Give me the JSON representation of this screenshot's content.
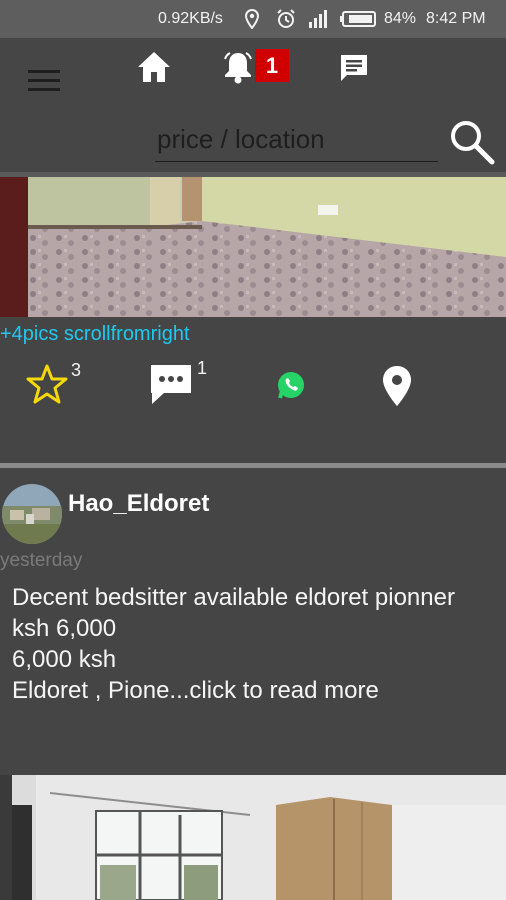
{
  "status_bar": {
    "speed": "0.92KB/s",
    "battery_pct": "84%",
    "time": "8:42 PM",
    "icons": [
      "location-icon",
      "alarm-icon",
      "signal-icon",
      "battery-icon"
    ]
  },
  "header": {
    "notification_count": "1",
    "search_placeholder": "price / location",
    "icons": [
      "menu-icon",
      "home-icon",
      "bell-icon",
      "chat-icon",
      "search-icon"
    ]
  },
  "post_1": {
    "more_pics_label": "+4pics scrollfromright",
    "star_count": "3",
    "comment_count": "1",
    "icons": [
      "star-icon",
      "comment-icon",
      "whatsapp-icon",
      "map-pin-icon"
    ]
  },
  "post_2": {
    "username": "Hao_Eldoret",
    "time": "yesterday",
    "text_lines": [
      "Decent bedsitter available eldoret pionner",
      "ksh 6,000",
      "6,000 ksh",
      "Eldoret , Pione...click to read more"
    ]
  },
  "colors": {
    "background": "#454545",
    "status_bar": "#5e5e5e",
    "badge": "#d10000",
    "link": "#1ec9f0",
    "star": "#f5d90a",
    "whatsapp": "#25d366"
  }
}
